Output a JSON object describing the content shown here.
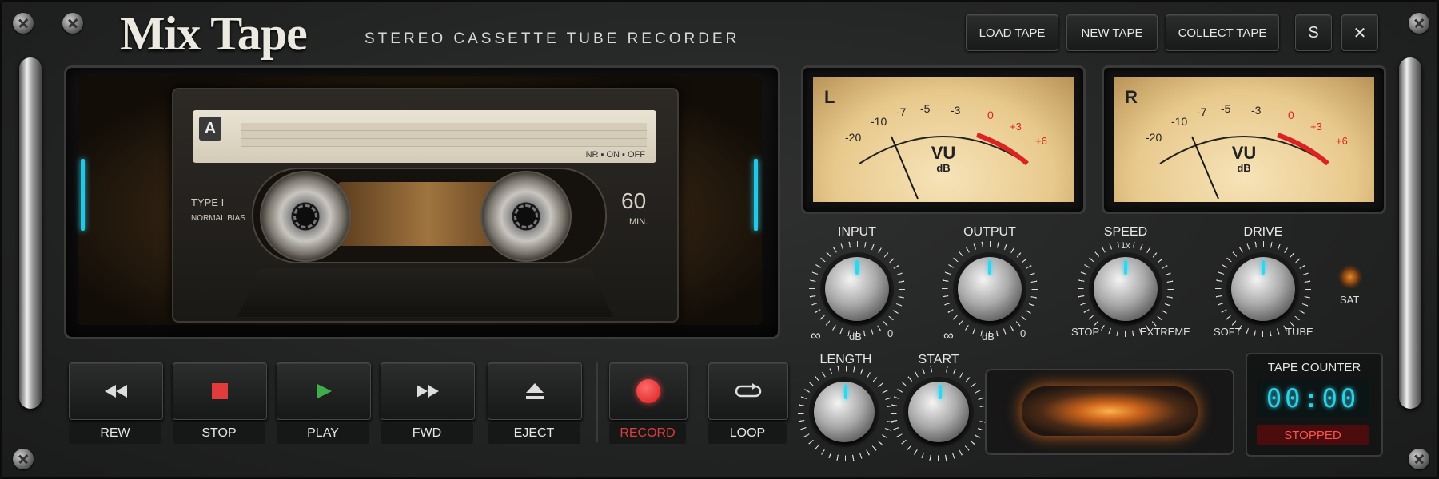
{
  "app": {
    "title": "Mix Tape",
    "subtitle": "STEREO CASSETTE TUBE RECORDER"
  },
  "header_buttons": {
    "load": "LOAD TAPE",
    "new": "NEW TAPE",
    "collect": "COLLECT TAPE",
    "s": "S",
    "close": "✕"
  },
  "cassette": {
    "side": "A",
    "nr": "NR",
    "on": "ON",
    "off": "OFF",
    "type": "TYPE I",
    "bias": "NORMAL BIAS",
    "minutes": "60",
    "minutes_unit": "MIN."
  },
  "vu_meters": [
    {
      "channel": "L",
      "label": "VU",
      "unit": "dB",
      "scale": [
        "-20",
        "-10",
        "-7",
        "-5",
        "-3",
        "0",
        "+3",
        "+6"
      ],
      "level": -12
    },
    {
      "channel": "R",
      "label": "VU",
      "unit": "dB",
      "scale": [
        "-20",
        "-10",
        "-7",
        "-5",
        "-3",
        "0",
        "+3",
        "+6"
      ],
      "level": -12
    }
  ],
  "knobs": {
    "input": {
      "label": "INPUT",
      "min": "∞",
      "mid": "dB",
      "max": "0"
    },
    "output": {
      "label": "OUTPUT",
      "min": "∞",
      "mid": "dB",
      "max": "0"
    },
    "speed": {
      "label": "SPEED",
      "top": "1x",
      "min": "STOP",
      "max": "EXTREME"
    },
    "drive": {
      "label": "DRIVE",
      "min": "SOFT",
      "max": "TUBE"
    },
    "length": {
      "label": "LENGTH"
    },
    "start": {
      "label": "START"
    }
  },
  "sat": {
    "label": "SAT"
  },
  "transport": {
    "rew": "REW",
    "stop": "STOP",
    "play": "PLAY",
    "fwd": "FWD",
    "eject": "EJECT",
    "record": "RECORD",
    "loop": "LOOP"
  },
  "counter": {
    "title": "TAPE COUNTER",
    "time": "00:00",
    "status": "STOPPED"
  },
  "colors": {
    "accent_cyan": "#2fd6f2",
    "record_red": "#e23b3b",
    "play_green": "#3fae4a",
    "counter_digits": "#2fd0e6"
  }
}
